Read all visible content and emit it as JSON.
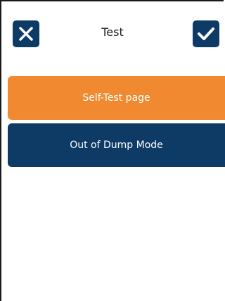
{
  "header": {
    "title": "Test",
    "cancel_icon": "close-icon",
    "confirm_icon": "check-icon"
  },
  "menu": {
    "items": [
      {
        "label": "Self-Test page",
        "color": "#f0892f"
      },
      {
        "label": "Out of Dump Mode",
        "color": "#0e3a66"
      }
    ]
  },
  "colors": {
    "accent_dark": "#0e3a66",
    "accent_orange": "#f0892f",
    "background": "#ffffff"
  }
}
